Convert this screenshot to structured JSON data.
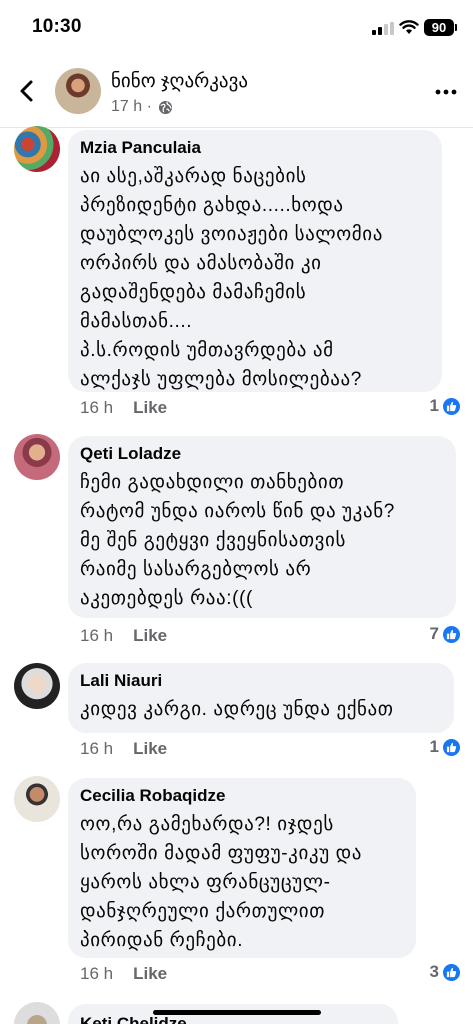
{
  "status": {
    "time": "10:30",
    "battery": "90"
  },
  "header": {
    "name": "ნინო ჯღარკავა",
    "time_ago": "17 h ·"
  },
  "comments": [
    {
      "name": "Mzia Panculaia",
      "text": "აი ასე,აშკარად ნაცების\nპრეზიდენტი გახდა.....ხოდა\nდაუბლოკეს ვოიაჟები სალომია\nორპირს და ამასობაში კი\nგადაშენდება მამაჩემის\nმამასთან....\nპ.ს.როდის უმთავრდება ამ\nალქაჯს უფლება მოსილებაა?",
      "time": "16 h",
      "like_label": "Like",
      "reactions": "1"
    },
    {
      "name": "Qeti Loladze",
      "text": "ჩემი გადახდილი თანხებით\nრატომ  უნდა იაროს წინ და უკან?\nმე შენ გეტყვი ქვეყნისათვის\nრაიმე სასარგებლოს არ\nაკეთებდეს რაა:(((",
      "time": "16 h",
      "like_label": "Like",
      "reactions": "7"
    },
    {
      "name": "Lali Niauri",
      "text": "კიდევ კარგი. ადრეც უნდა ექნათ",
      "time": "16 h",
      "like_label": "Like",
      "reactions": "1"
    },
    {
      "name": "Cecilia Robaqidze",
      "text": "ოო,რა გამეხარდა?! იჯდეს\nსოროში მადამ ფუფუ-კიკუ და\nყაროს ახლა ფრანცუცულ-\nდანჯღრეული ქართულით\nპირიდან რეჩები.",
      "time": "16 h",
      "like_label": "Like",
      "reactions": "3"
    },
    {
      "name": "Keti Chelidze"
    }
  ],
  "colors": {
    "accent": "#1877f2",
    "bubble": "#f0f2f5",
    "meta": "#65676b"
  },
  "icons": [
    "back-chevron-icon",
    "globe-icon",
    "more-dots-icon",
    "like-reaction-icon"
  ]
}
